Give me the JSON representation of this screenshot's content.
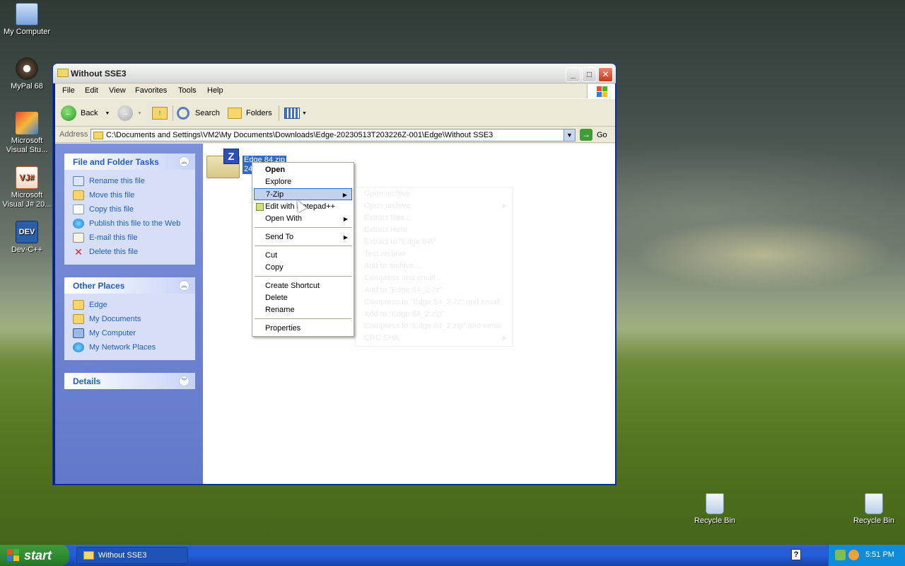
{
  "desktop": {
    "icons": [
      {
        "label": "My Computer"
      },
      {
        "label": "MyPal 68"
      },
      {
        "label": "Microsoft Visual Stu..."
      },
      {
        "label": "Microsoft Visual J# 20..."
      },
      {
        "label": "Dev-C++"
      },
      {
        "label": "Recycle Bin"
      },
      {
        "label": "Recycle Bin"
      }
    ]
  },
  "window": {
    "title": "Without SSE3",
    "menu": [
      "File",
      "Edit",
      "View",
      "Favorites",
      "Tools",
      "Help"
    ],
    "toolbar": {
      "back": "Back",
      "search": "Search",
      "folders": "Folders"
    },
    "address": {
      "label": "Address",
      "path": "C:\\Documents and Settings\\VM2\\My Documents\\Downloads\\Edge-20230513T203226Z-001\\Edge\\Without SSE3",
      "go": "Go"
    },
    "file_tasks": {
      "title": "File and Folder Tasks",
      "items": [
        "Rename this file",
        "Move this file",
        "Copy this file",
        "Publish this file to the Web",
        "E-mail this file",
        "Delete this file"
      ]
    },
    "other_places": {
      "title": "Other Places",
      "items": [
        "Edge",
        "My Documents",
        "My Computer",
        "My Network Places"
      ]
    },
    "details": {
      "title": "Details"
    },
    "file": {
      "name": "Edge 84.zip",
      "size": "24"
    }
  },
  "context_menu": {
    "items": [
      "Open",
      "Explore",
      "7-Zip",
      "Edit with Notepad++",
      "Open With",
      "Send To",
      "Cut",
      "Copy",
      "Create Shortcut",
      "Delete",
      "Rename",
      "Properties"
    ]
  },
  "submenu_7zip": {
    "items": [
      "Open archive",
      "Open archive",
      "Extract files...",
      "Extract Here",
      "Extract to \"Edge 84\\\"",
      "Test archive",
      "Add to archive...",
      "Compress and email...",
      "Add to \"Edge 84_2.7z\"",
      "Compress to \"Edge 84_2.7z\" and email",
      "Add to \"Edge 84_2.zip\"",
      "Compress to \"Edge 84_2.zip\" and email",
      "CRC SHA"
    ]
  },
  "taskbar": {
    "start": "start",
    "task": "Without SSE3",
    "clock": "5:51 PM"
  }
}
